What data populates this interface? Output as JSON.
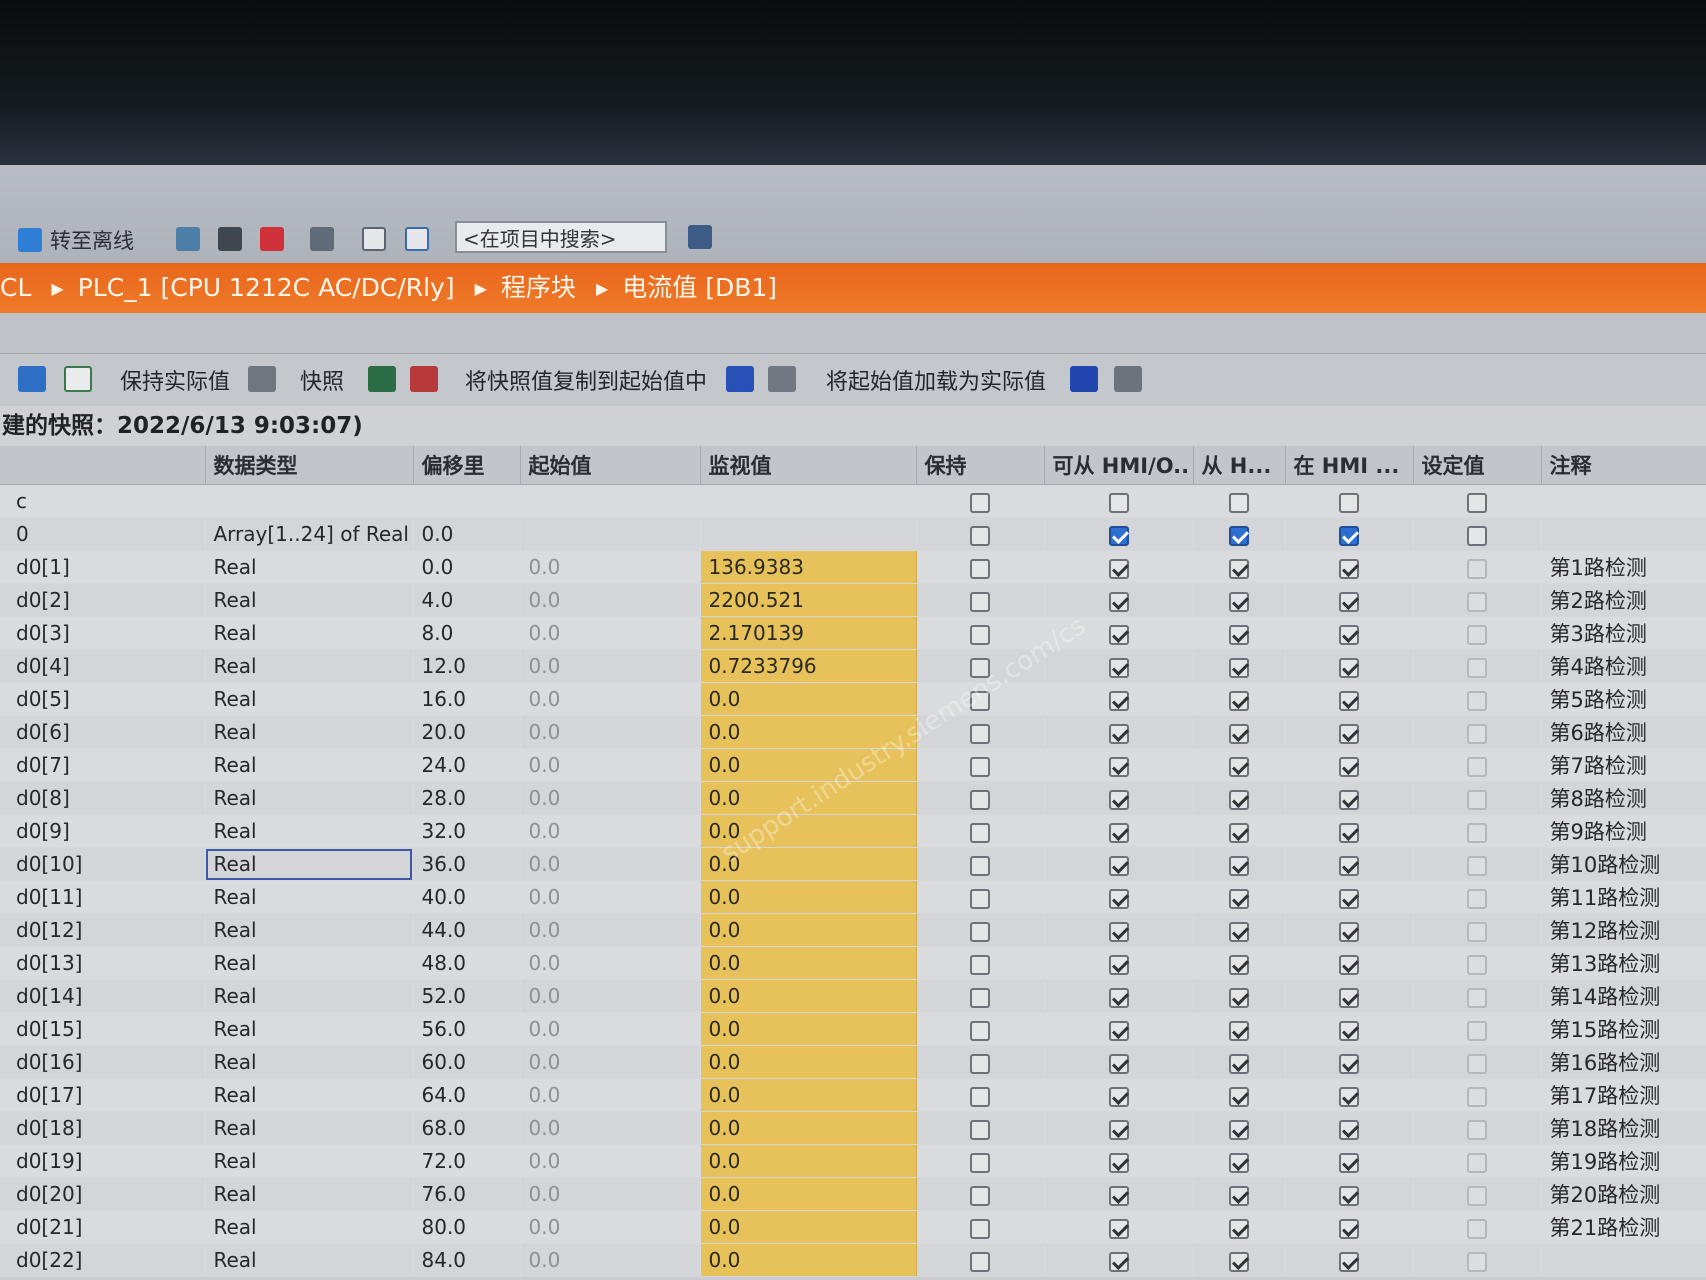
{
  "toolbar": {
    "go_offline": "转至离线",
    "search_placeholder": "<在项目中搜索>"
  },
  "breadcrumb": [
    "CL",
    "PLC_1 [CPU 1212C AC/DC/Rly]",
    "程序块",
    "电流值 [DB1]"
  ],
  "block_toolbar": {
    "keep_actual": "保持实际值",
    "snapshot": "快照",
    "copy_snapshot": "将快照值复制到起始值中",
    "load_start": "将起始值加载为实际值"
  },
  "snapshot_label": "建的快照：2022/6/13 9:03:07)",
  "watermark": "support.industry.siemens.com/cs",
  "columns": [
    "",
    "数据类型",
    "偏移里",
    "起始值",
    "监视值",
    "保持",
    "可从 HMI/O..",
    "从 H...",
    "在 HMI ...",
    "设定值",
    "注释"
  ],
  "header_rows": [
    {
      "name": "c",
      "type": "",
      "offset": "",
      "start": "",
      "monitor": "",
      "note": "",
      "flags": [
        false,
        false,
        false,
        false,
        false
      ]
    },
    {
      "name": "0",
      "type": "Array[1..24] of Real",
      "offset": "0.0",
      "start": "",
      "monitor": "",
      "note": "",
      "flags": [
        false,
        true,
        true,
        true,
        false
      ]
    }
  ],
  "rows": [
    {
      "name": "d0[1]",
      "type": "Real",
      "offset": "0.0",
      "start": "0.0",
      "monitor": "136.9383",
      "note": "第1路检测"
    },
    {
      "name": "d0[2]",
      "type": "Real",
      "offset": "4.0",
      "start": "0.0",
      "monitor": "2200.521",
      "note": "第2路检测"
    },
    {
      "name": "d0[3]",
      "type": "Real",
      "offset": "8.0",
      "start": "0.0",
      "monitor": "2.170139",
      "note": "第3路检测"
    },
    {
      "name": "d0[4]",
      "type": "Real",
      "offset": "12.0",
      "start": "0.0",
      "monitor": "0.7233796",
      "note": "第4路检测"
    },
    {
      "name": "d0[5]",
      "type": "Real",
      "offset": "16.0",
      "start": "0.0",
      "monitor": "0.0",
      "note": "第5路检测"
    },
    {
      "name": "d0[6]",
      "type": "Real",
      "offset": "20.0",
      "start": "0.0",
      "monitor": "0.0",
      "note": "第6路检测"
    },
    {
      "name": "d0[7]",
      "type": "Real",
      "offset": "24.0",
      "start": "0.0",
      "monitor": "0.0",
      "note": "第7路检测"
    },
    {
      "name": "d0[8]",
      "type": "Real",
      "offset": "28.0",
      "start": "0.0",
      "monitor": "0.0",
      "note": "第8路检测"
    },
    {
      "name": "d0[9]",
      "type": "Real",
      "offset": "32.0",
      "start": "0.0",
      "monitor": "0.0",
      "note": "第9路检测"
    },
    {
      "name": "d0[10]",
      "type": "Real",
      "offset": "36.0",
      "start": "0.0",
      "monitor": "0.0",
      "note": "第10路检测"
    },
    {
      "name": "d0[11]",
      "type": "Real",
      "offset": "40.0",
      "start": "0.0",
      "monitor": "0.0",
      "note": "第11路检测"
    },
    {
      "name": "d0[12]",
      "type": "Real",
      "offset": "44.0",
      "start": "0.0",
      "monitor": "0.0",
      "note": "第12路检测"
    },
    {
      "name": "d0[13]",
      "type": "Real",
      "offset": "48.0",
      "start": "0.0",
      "monitor": "0.0",
      "note": "第13路检测"
    },
    {
      "name": "d0[14]",
      "type": "Real",
      "offset": "52.0",
      "start": "0.0",
      "monitor": "0.0",
      "note": "第14路检测"
    },
    {
      "name": "d0[15]",
      "type": "Real",
      "offset": "56.0",
      "start": "0.0",
      "monitor": "0.0",
      "note": "第15路检测"
    },
    {
      "name": "d0[16]",
      "type": "Real",
      "offset": "60.0",
      "start": "0.0",
      "monitor": "0.0",
      "note": "第16路检测"
    },
    {
      "name": "d0[17]",
      "type": "Real",
      "offset": "64.0",
      "start": "0.0",
      "monitor": "0.0",
      "note": "第17路检测"
    },
    {
      "name": "d0[18]",
      "type": "Real",
      "offset": "68.0",
      "start": "0.0",
      "monitor": "0.0",
      "note": "第18路检测"
    },
    {
      "name": "d0[19]",
      "type": "Real",
      "offset": "72.0",
      "start": "0.0",
      "monitor": "0.0",
      "note": "第19路检测"
    },
    {
      "name": "d0[20]",
      "type": "Real",
      "offset": "76.0",
      "start": "0.0",
      "monitor": "0.0",
      "note": "第20路检测"
    },
    {
      "name": "d0[21]",
      "type": "Real",
      "offset": "80.0",
      "start": "0.0",
      "monitor": "0.0",
      "note": "第21路检测"
    },
    {
      "name": "d0[22]",
      "type": "Real",
      "offset": "84.0",
      "start": "0.0",
      "monitor": "0.0",
      "note": ""
    }
  ],
  "selected_row": "d0[10]",
  "colors": {
    "accent": "#ec6f22",
    "monitor_bg": "#e7c25a",
    "check_blue": "#2d6fd1"
  }
}
